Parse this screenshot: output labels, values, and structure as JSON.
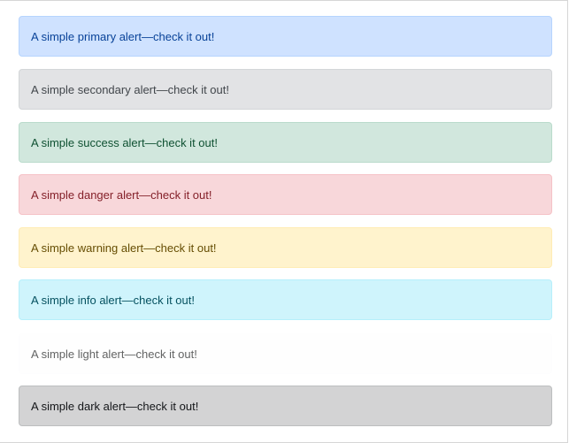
{
  "alerts": [
    {
      "variant": "primary",
      "text": "A simple primary alert—check it out!",
      "bg": "#cfe2ff",
      "border": "#b6d4fe",
      "color": "#084298"
    },
    {
      "variant": "secondary",
      "text": "A simple secondary alert—check it out!",
      "bg": "#e2e3e5",
      "border": "#d3d6d8",
      "color": "#41464b"
    },
    {
      "variant": "success",
      "text": "A simple success alert—check it out!",
      "bg": "#d1e7dd",
      "border": "#badbcc",
      "color": "#0f5132"
    },
    {
      "variant": "danger",
      "text": "A simple danger alert—check it out!",
      "bg": "#f8d7da",
      "border": "#f5c2c7",
      "color": "#842029"
    },
    {
      "variant": "warning",
      "text": "A simple warning alert—check it out!",
      "bg": "#fff3cd",
      "border": "#ffecb5",
      "color": "#664d03"
    },
    {
      "variant": "info",
      "text": "A simple info alert—check it out!",
      "bg": "#cff4fc",
      "border": "#b6effb",
      "color": "#055160"
    },
    {
      "variant": "light",
      "text": "A simple light alert—check it out!",
      "bg": "#fefefe",
      "border": "#fdfdfe",
      "color": "#636464"
    },
    {
      "variant": "dark",
      "text": "A simple dark alert—check it out!",
      "bg": "#d3d3d4",
      "border": "#bcbebf",
      "color": "#141619"
    }
  ]
}
